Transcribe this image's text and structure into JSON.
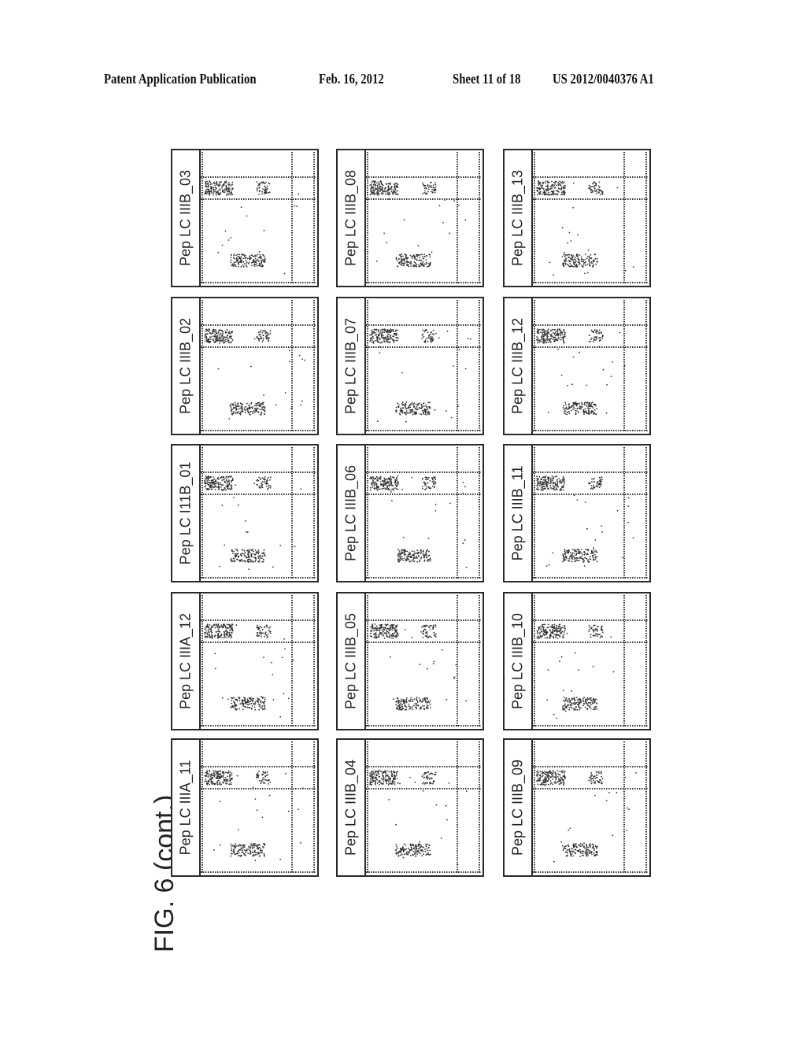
{
  "header": {
    "publication": "Patent Application Publication",
    "date": "Feb. 16, 2012",
    "sheet": "Sheet 11 of 18",
    "number": "US 2012/0040376 A1"
  },
  "figure_title": "FIG. 6 (cont.)",
  "panels": [
    {
      "label": "Pep LC IIIA_11",
      "row": 0,
      "col": 0
    },
    {
      "label": "Pep LC IIIA_12",
      "row": 0,
      "col": 1
    },
    {
      "label": "Pep LC I11B_01",
      "row": 0,
      "col": 2
    },
    {
      "label": "Pep LC IIIB_02",
      "row": 0,
      "col": 3
    },
    {
      "label": "Pep LC IIIB_03",
      "row": 0,
      "col": 4
    },
    {
      "label": "Pep LC IIIB_04",
      "row": 1,
      "col": 0
    },
    {
      "label": "Pep LC IIIB_05",
      "row": 1,
      "col": 1
    },
    {
      "label": "Pep LC IIIB_06",
      "row": 1,
      "col": 2
    },
    {
      "label": "Pep LC IIIB_07",
      "row": 1,
      "col": 3
    },
    {
      "label": "Pep LC IIIB_08",
      "row": 1,
      "col": 4
    },
    {
      "label": "Pep LC IIIB_09",
      "row": 2,
      "col": 0
    },
    {
      "label": "Pep LC IIIB_10",
      "row": 2,
      "col": 1
    },
    {
      "label": "Pep LC IIIB_11",
      "row": 2,
      "col": 2
    },
    {
      "label": "Pep LC IIIB_12",
      "row": 2,
      "col": 3
    },
    {
      "label": "Pep LC IIIB_13",
      "row": 2,
      "col": 4
    }
  ]
}
